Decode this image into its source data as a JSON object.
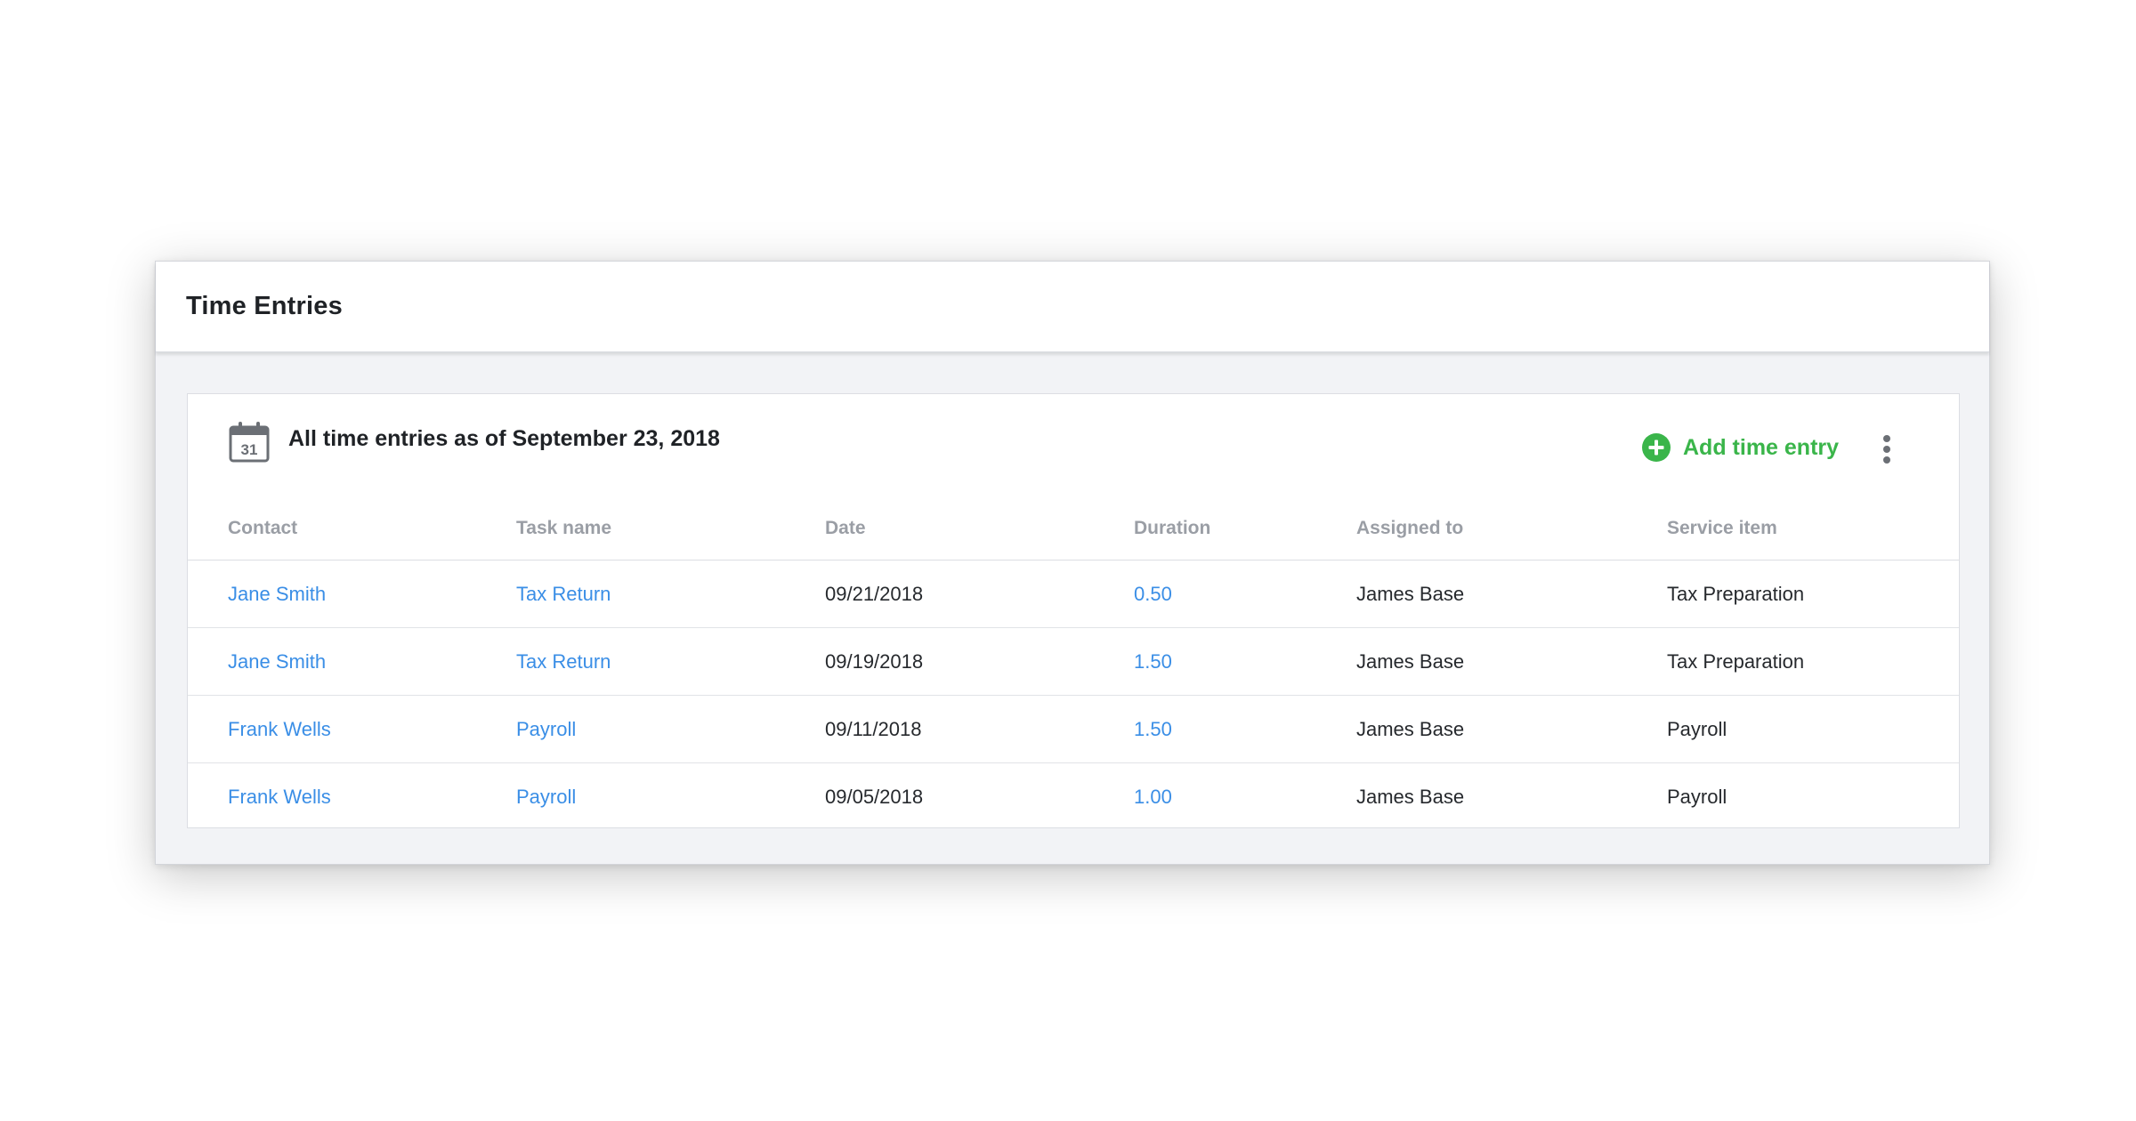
{
  "window": {
    "title": "Time Entries"
  },
  "card": {
    "heading": "All time entries as of September 23, 2018",
    "calendar_day": "31",
    "add_label": "Add time entry",
    "icons": {
      "calendar": "calendar-icon",
      "add": "plus-circle-icon",
      "more": "more-vertical-icon"
    },
    "accent_color": "#3ab54a",
    "link_color": "#3a8ee6"
  },
  "table": {
    "columns": [
      "Contact",
      "Task name",
      "Date",
      "Duration",
      "Assigned to",
      "Service item"
    ],
    "rows": [
      {
        "contact": "Jane Smith",
        "task": "Tax Return",
        "date": "09/21/2018",
        "duration": "0.50",
        "assigned": "James Base",
        "service": "Tax Preparation"
      },
      {
        "contact": "Jane Smith",
        "task": "Tax Return",
        "date": "09/19/2018",
        "duration": "1.50",
        "assigned": "James Base",
        "service": "Tax Preparation"
      },
      {
        "contact": "Frank Wells",
        "task": "Payroll",
        "date": "09/11/2018",
        "duration": "1.50",
        "assigned": "James Base",
        "service": "Payroll"
      },
      {
        "contact": "Frank Wells",
        "task": "Payroll",
        "date": "09/05/2018",
        "duration": "1.00",
        "assigned": "James Base",
        "service": "Payroll"
      }
    ]
  }
}
